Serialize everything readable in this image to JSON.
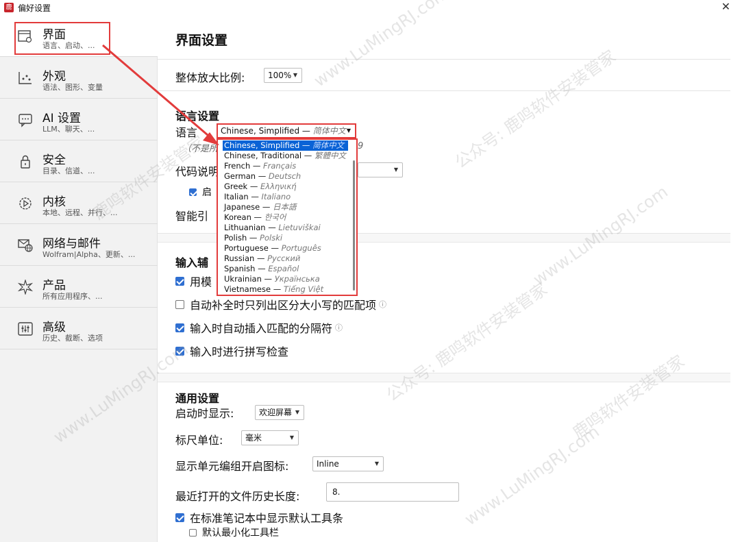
{
  "window": {
    "title": "偏好设置",
    "icon_glyph": "鹿",
    "close_glyph": "✕"
  },
  "sidebar": {
    "items": [
      {
        "label": "界面",
        "sub": "语言、启动、..."
      },
      {
        "label": "外观",
        "sub": "语法、图形、变量"
      },
      {
        "label": "AI 设置",
        "sub": "LLM、聊天、..."
      },
      {
        "label": "安全",
        "sub": "目录、信道、..."
      },
      {
        "label": "内核",
        "sub": "本地、远程、并行、..."
      },
      {
        "label": "网络与邮件",
        "sub": "Wolfram|Alpha、更新、..."
      },
      {
        "label": "产品",
        "sub": "所有应用程序、..."
      },
      {
        "label": "高级",
        "sub": "历史、截断、选项"
      }
    ]
  },
  "main": {
    "title": "界面设置",
    "zoom_label": "整体放大比例:",
    "zoom_value": "100%",
    "language_section": "语言设置",
    "language_label": "语言",
    "language_note": "（不是所",
    "language_note_tail": "9",
    "code_label": "代码说明",
    "startup_check_label": "启",
    "smart_label": "智能引",
    "input_section": "输入辅",
    "input_checks": [
      {
        "label": "用模",
        "checked": true
      },
      {
        "label": "自动补全时只列出区分大小写的匹配项",
        "checked": false,
        "info": true
      },
      {
        "label": "输入时自动插入匹配的分隔符",
        "checked": true,
        "info": true
      },
      {
        "label": "输入时进行拼写检查",
        "checked": true
      }
    ],
    "general_section": "通用设置",
    "startup_label": "启动时显示:",
    "startup_value": "欢迎屏幕",
    "ruler_label": "标尺单位:",
    "ruler_value": "毫米",
    "cellgroup_label": "显示单元编组开启图标:",
    "cellgroup_value": "Inline",
    "history_label": "最近打开的文件历史长度:",
    "history_value": "8.",
    "toolbar_check": "在标准笔记本中显示默认工具条",
    "minimize_check": "默认最小化工具栏",
    "info_glyph": "ⓘ"
  },
  "language_dropdown": {
    "selected": "Chinese, Simplified",
    "selected_native": "简体中文",
    "dash": "—",
    "options": [
      {
        "name": "Chinese, Simplified",
        "native": "简体中文"
      },
      {
        "name": "Chinese, Traditional",
        "native": "繁體中文"
      },
      {
        "name": "French",
        "native": "Français"
      },
      {
        "name": "German",
        "native": "Deutsch"
      },
      {
        "name": "Greek",
        "native": "Ελληνική"
      },
      {
        "name": "Italian",
        "native": "Italiano"
      },
      {
        "name": "Japanese",
        "native": "日本語"
      },
      {
        "name": "Korean",
        "native": "한국어"
      },
      {
        "name": "Lithuanian",
        "native": "Lietuviškai"
      },
      {
        "name": "Polish",
        "native": "Polski"
      },
      {
        "name": "Portuguese",
        "native": "Português"
      },
      {
        "name": "Russian",
        "native": "Русский"
      },
      {
        "name": "Spanish",
        "native": "Español"
      },
      {
        "name": "Ukrainian",
        "native": "Українська"
      },
      {
        "name": "Vietnamese",
        "native": "Tiếng Việt"
      }
    ]
  },
  "watermark": {
    "texts": [
      "www.LuMingRJ.com",
      "公众号: 鹿鸣软件安装管家",
      "鹿鸣软件安装管家"
    ]
  },
  "colors": {
    "accent": "#2f6fd1",
    "highlight_red": "#e23b3b",
    "dropdown_selected": "#0a63d6"
  }
}
